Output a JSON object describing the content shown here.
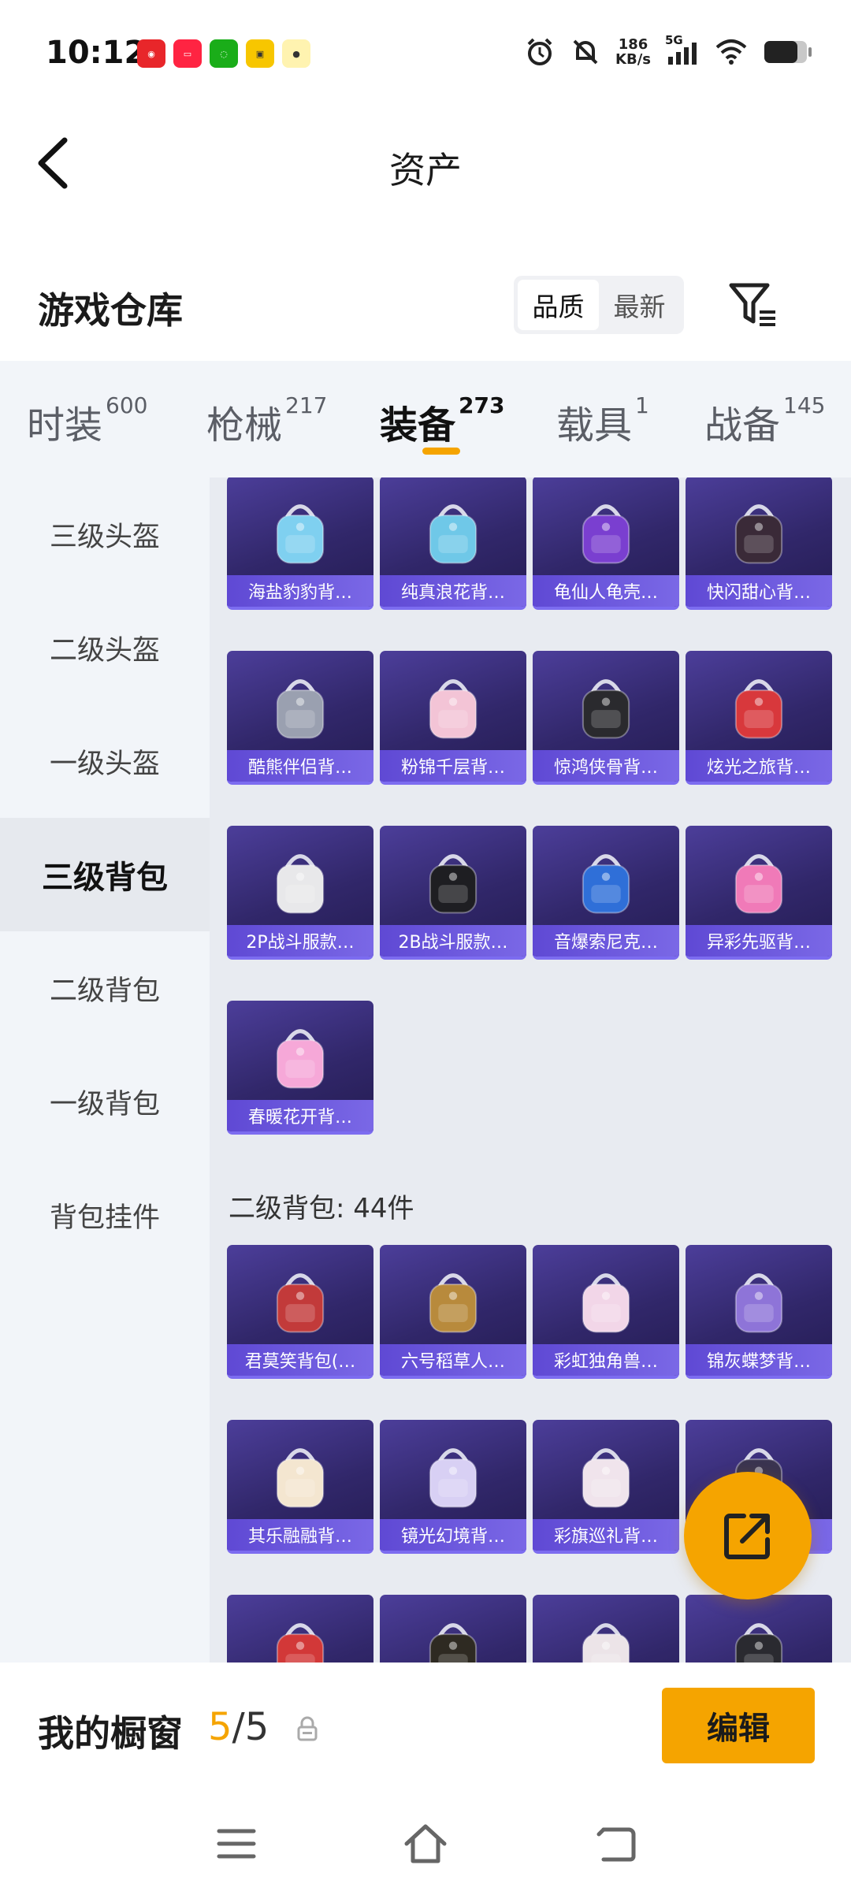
{
  "status": {
    "time": "10:12",
    "speed_value": "186",
    "speed_unit": "KB/s",
    "network": "5G",
    "app_icons": [
      "netease-music",
      "xiaohongshu",
      "wechat",
      "app-yellow",
      "app-cat"
    ]
  },
  "header": {
    "title": "资产"
  },
  "warehouse": {
    "title": "游戏仓库",
    "sort_options": [
      "品质",
      "最新"
    ],
    "sort_active": "品质"
  },
  "tabs": [
    {
      "label": "时装",
      "count": "600"
    },
    {
      "label": "枪械",
      "count": "217"
    },
    {
      "label": "装备",
      "count": "273"
    },
    {
      "label": "载具",
      "count": "1"
    },
    {
      "label": "战备",
      "count": "145"
    }
  ],
  "active_tab": "装备",
  "sidebar": [
    {
      "label": "三级头盔"
    },
    {
      "label": "二级头盔"
    },
    {
      "label": "一级头盔"
    },
    {
      "label": "三级背包"
    },
    {
      "label": "二级背包"
    },
    {
      "label": "一级背包"
    },
    {
      "label": "背包挂件"
    }
  ],
  "active_sidebar": "三级背包",
  "level3_items": [
    {
      "name": "海盐豹豹背…",
      "color": "#7fd0f0"
    },
    {
      "name": "纯真浪花背…",
      "color": "#6fc8e8"
    },
    {
      "name": "龟仙人龟壳…",
      "color": "#7a3fd0"
    },
    {
      "name": "快闪甜心背…",
      "color": "#3a2a38"
    },
    {
      "name": "酷熊伴侣背…",
      "color": "#9aa0b0"
    },
    {
      "name": "粉锦千层背…",
      "color": "#f3c4d6"
    },
    {
      "name": "惊鸿侠骨背…",
      "color": "#2a2a2e"
    },
    {
      "name": "炫光之旅背…",
      "color": "#d8383c"
    },
    {
      "name": "2P战斗服款…",
      "color": "#e8e8ea"
    },
    {
      "name": "2B战斗服款…",
      "color": "#1e1e22"
    },
    {
      "name": "音爆索尼克…",
      "color": "#2f6fd8"
    },
    {
      "name": "异彩先驱背…",
      "color": "#f07ab8"
    },
    {
      "name": "春暖花开背…",
      "color": "#f6a8d8"
    }
  ],
  "section2": {
    "title": "二级背包: 44件"
  },
  "level2_items": [
    {
      "name": "君莫笑背包(…",
      "color": "#c23a3a"
    },
    {
      "name": "六号稻草人…",
      "color": "#b88a3c"
    },
    {
      "name": "彩虹独角兽…",
      "color": "#f2d6e8"
    },
    {
      "name": "锦灰蝶梦背…",
      "color": "#8e74d8"
    },
    {
      "name": "其乐融融背…",
      "color": "#f4e6d0"
    },
    {
      "name": "镜光幻境背…",
      "color": "#d8d0f4"
    },
    {
      "name": "彩旗巡礼背…",
      "color": "#f0e4ec"
    },
    {
      "name": "",
      "color": "#3a3450"
    },
    {
      "name": "",
      "color": "#d23838"
    },
    {
      "name": "",
      "color": "#2e2a22"
    },
    {
      "name": "",
      "color": "#ece4e8"
    },
    {
      "name": "",
      "color": "#2a2a30"
    }
  ],
  "bottom": {
    "showcase_label": "我的橱窗",
    "count_current": "5",
    "count_sep": "/",
    "count_total": "5",
    "edit_label": "编辑"
  },
  "colors": {
    "accent": "#f5a400",
    "card_bg": "#31276a",
    "card_label": "#6b55dc"
  }
}
